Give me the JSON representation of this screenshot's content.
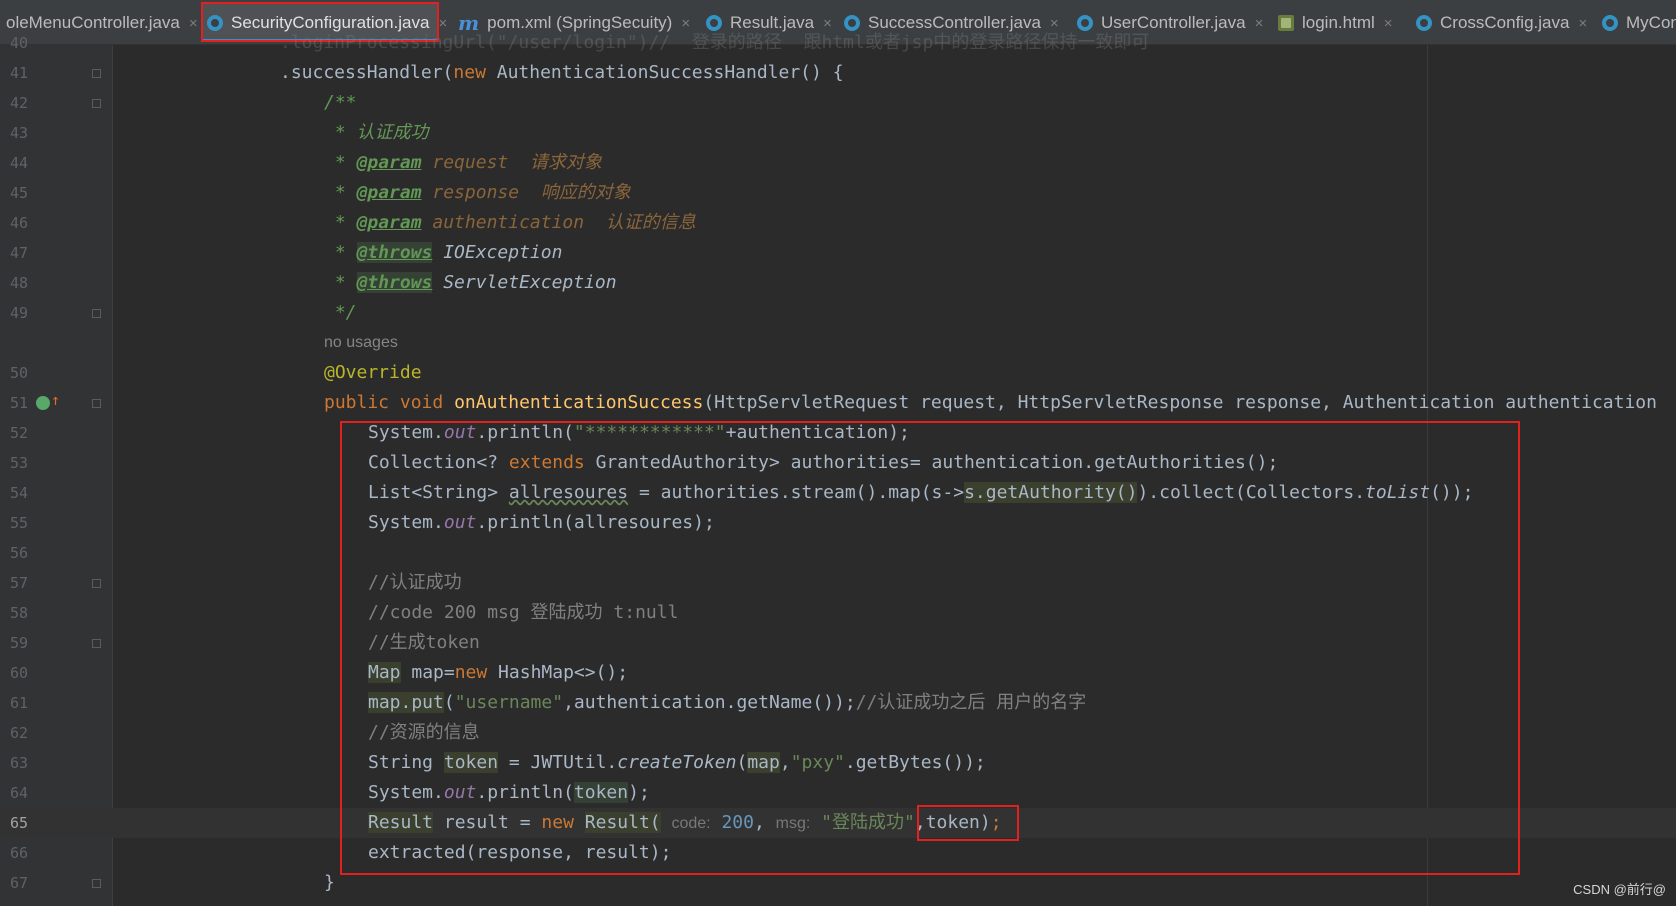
{
  "tabs": [
    {
      "label": "oleMenuController.java",
      "icon": "class-icon",
      "active": false
    },
    {
      "label": "SecurityConfiguration.java",
      "icon": "class-icon",
      "active": true
    },
    {
      "label": "pom.xml (SpringSecuity)",
      "icon": "maven-icon",
      "active": false
    },
    {
      "label": "Result.java",
      "icon": "class-icon",
      "active": false
    },
    {
      "label": "SuccessController.java",
      "icon": "class-icon",
      "active": false
    },
    {
      "label": "UserController.java",
      "icon": "class-icon",
      "active": false
    },
    {
      "label": "login.html",
      "icon": "html-icon",
      "active": false
    },
    {
      "label": "CrossConfig.java",
      "icon": "class-icon",
      "active": false
    },
    {
      "label": "MyCon",
      "icon": "class-icon",
      "active": false
    }
  ],
  "close_glyph": "×",
  "editor": {
    "line_numbers": [
      "40",
      "41",
      "42",
      "43",
      "44",
      "45",
      "46",
      "47",
      "48",
      "49",
      "50",
      "51",
      "52",
      "53",
      "54",
      "55",
      "56",
      "57",
      "58",
      "59",
      "60",
      "61",
      "62",
      "63",
      "64",
      "65",
      "66",
      "67"
    ],
    "current_line": "65",
    "line40": ".loginProcessingUrl(\"/user/login\")//  登录的路径  跟html或者jsp中的登录路径保持一致即可",
    "line41": {
      "a": ".successHandler(",
      "kw": "new",
      "b": " AuthenticationSuccessHandler() {"
    },
    "line42": "/**",
    "line43": " * 认证成功",
    "line44": {
      "a": " * ",
      "tag": "@param",
      "b": " request  请求对象"
    },
    "line45": {
      "a": " * ",
      "tag": "@param",
      "b": " response  响应的对象"
    },
    "line46": {
      "a": " * ",
      "tag": "@param",
      "b": " authentication  认证的信息"
    },
    "line47": {
      "a": " * ",
      "tag": "@throws",
      "b": " IOException"
    },
    "line48": {
      "a": " * ",
      "tag": "@throws",
      "b": " ServletException"
    },
    "line49": " */",
    "usages": "no usages",
    "line50": "@Override",
    "line51": {
      "k1": "public",
      "k2": "void",
      "fn": "onAuthenticationSuccess",
      "rest": "(HttpServletRequest request, HttpServletResponse response, Authentication authentication"
    },
    "line52": {
      "a": "System.",
      "st": "out",
      "b": ".println(",
      "str": "\"************\"",
      "c": "+authentication);"
    },
    "line53": {
      "a": "Collection<? ",
      "kw": "extends",
      "b": " GrantedAuthority> authorities= authentication.getAuthorities();"
    },
    "line54": {
      "a": "List<String> ",
      "var": "allresoures",
      "b": " = authorities.stream().map(s->",
      "hl": "s.getAuthority()",
      "c": ").collect(Collectors.",
      "it": "toList",
      "d": "());"
    },
    "line55": "System.out.println(allresoures);",
    "line55a": "System.",
    "line55st": "out",
    "line55b": ".println(allresoures);",
    "line57": "//认证成功",
    "line58": "//code 200 msg 登陆成功 t:null",
    "line59": "//生成token",
    "line60": {
      "hl": "Map",
      "a": " map=",
      "kw": "new",
      "b": " HashMap<>();"
    },
    "line61": {
      "hl": "map.put",
      "a": "(",
      "str": "\"username\"",
      "b": ",authentication.getName());",
      "cm": "//认证成功之后 用户的名字"
    },
    "line62": "//资源的信息",
    "line63": {
      "a": "String ",
      "hl": "token",
      "b": " = JWTUtil.",
      "it": "createToken",
      "c": "(",
      "hl2": "map",
      "d": ",",
      "str": "\"pxy\"",
      "e": ".getBytes());"
    },
    "line64": {
      "a": "System.",
      "st": "out",
      "b": ".println(",
      "hl": "token",
      "c": ");"
    },
    "line65": {
      "hl": "Result",
      "a": " result = ",
      "kw": "new",
      "sp": " ",
      "hl2": "Result(",
      "hint1": "code:",
      "num": "200",
      "d": ",",
      "hint2": "msg:",
      "str": "\"登陆成功\"",
      "tok": ",token)",
      "e": ";"
    },
    "line66": "extracted(response, result);",
    "line67": "}"
  },
  "watermark": "CSDN @前行@",
  "colors": {
    "keyword": "#cc7832",
    "string": "#6a8759",
    "number": "#6897bb",
    "method": "#ffc66d",
    "annotation": "#bbb529",
    "static_field": "#9876aa",
    "comment": "#808080",
    "javadoc": "#629755",
    "highlight_box": "#e0211f",
    "tab_underline": "#4a88c7"
  }
}
